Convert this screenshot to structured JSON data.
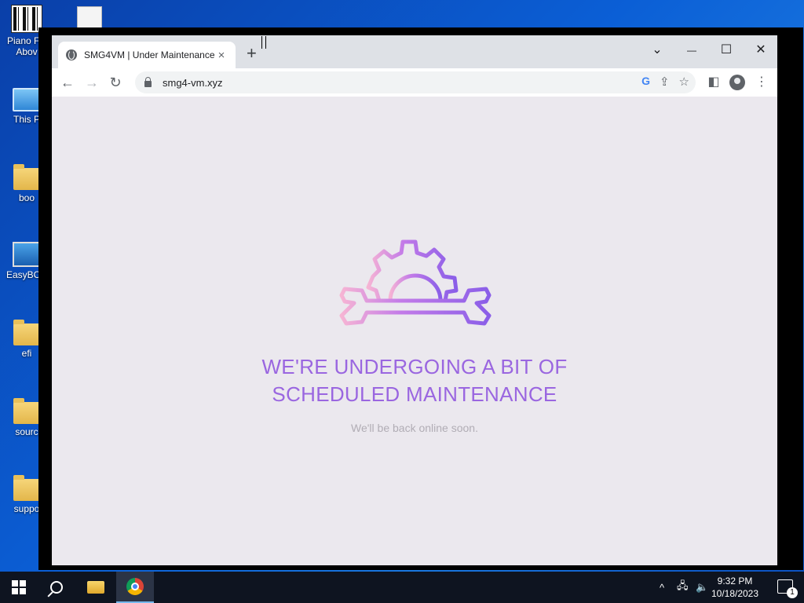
{
  "desktop": {
    "icons": [
      {
        "label": "Piano F... Abov"
      },
      {
        "label": "This P"
      },
      {
        "label": "boo"
      },
      {
        "label": "EasyBCD"
      },
      {
        "label": "efi"
      },
      {
        "label": "sourc"
      },
      {
        "label": "suppo"
      }
    ]
  },
  "browser": {
    "tab": {
      "title": "SMG4VM | Under Maintenance",
      "close": "×",
      "icon": "globe-icon"
    },
    "new_tab": "+",
    "window_controls": {
      "tab_search": "⌄",
      "minimize": "—",
      "maximize": "☐",
      "close": "✕"
    },
    "nav": {
      "back": "←",
      "forward": "→",
      "reload": "↻"
    },
    "address": {
      "url": "smg4-vm.xyz"
    },
    "omnibox_icons": {
      "google": "G",
      "share": "⇪",
      "bookmark": "☆"
    },
    "toolbar_right": {
      "side_panel": "◧",
      "menu": "⋮"
    }
  },
  "page": {
    "headline_line1": "WE'RE UNDERGOING A BIT OF",
    "headline_line2": "SCHEDULED MAINTENANCE",
    "subline": "We'll be back online soon.",
    "accent": "#9a66e0",
    "icon": "gear-wrench-icon"
  },
  "taskbar": {
    "tray": {
      "chevron": "^",
      "network": "🖧",
      "volume": "🔈"
    },
    "time": "9:32 PM",
    "date": "10/18/2023",
    "notification_count": "1"
  }
}
